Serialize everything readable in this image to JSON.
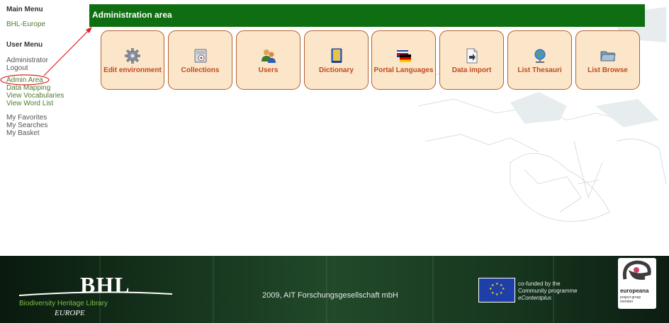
{
  "sidebar": {
    "main_menu_title": "Main Menu",
    "main_menu_items": [
      "BHL-Europe"
    ],
    "user_menu_title": "User Menu",
    "user_menu_items": [
      "Administrator",
      "Logout",
      "Admin Area",
      "Data Mapping",
      "View Vocabularies",
      "View Word List",
      "My Favorites",
      "My Searches",
      "My Basket"
    ]
  },
  "header": {
    "title": "Administration area"
  },
  "tiles": [
    {
      "label": "Edit environment",
      "icon": "gear-icon"
    },
    {
      "label": "Collections",
      "icon": "collection-icon"
    },
    {
      "label": "Users",
      "icon": "users-icon"
    },
    {
      "label": "Dictionary",
      "icon": "dictionary-icon"
    },
    {
      "label": "Portal Languages",
      "icon": "flag-icon"
    },
    {
      "label": "Data import",
      "icon": "import-icon"
    },
    {
      "label": "List Thesauri",
      "icon": "globe-icon"
    },
    {
      "label": "List Browse",
      "icon": "folder-icon"
    }
  ],
  "annotation": {
    "color": "#e02020"
  },
  "colors": {
    "header": "#0f6e12",
    "tile_bg": "#fbe6c9",
    "tile_border": "#b5602f",
    "tile_text": "#c04a1f",
    "link": "#4e7a2e"
  },
  "footer": {
    "logo_text": "BHL",
    "logo_subtitle": "Biodiversity Heritage Library",
    "logo_region": "EUROPE",
    "copyright": "2009, AIT Forschungsgesellschaft mbH",
    "cofunded": [
      "co-funded by the",
      "Community programme",
      "eContentplus"
    ],
    "europeana_name": "europeana",
    "europeana_tag": "project group member"
  }
}
